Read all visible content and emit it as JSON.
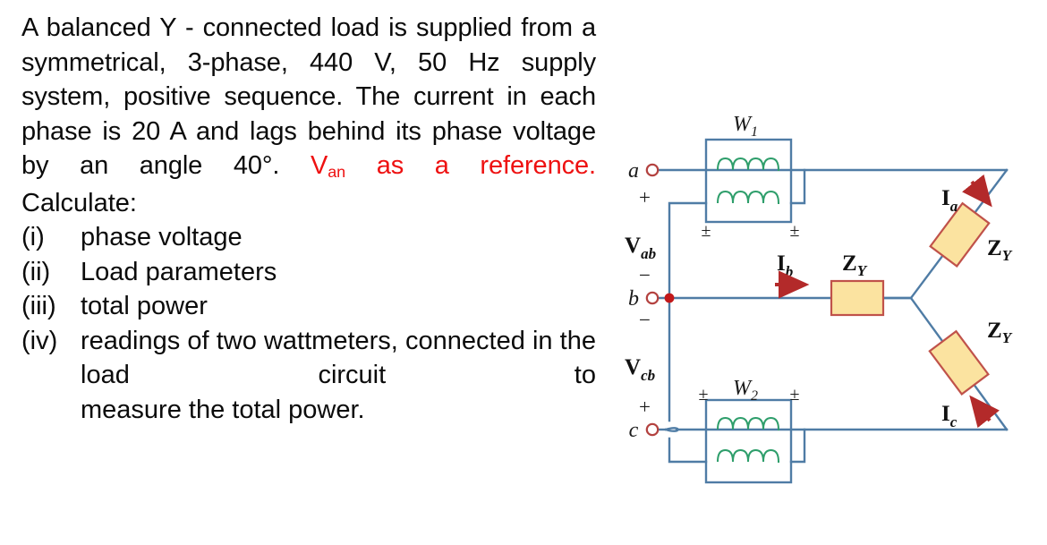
{
  "question": {
    "body_lines": [
      "A balanced Y - connected load is",
      "supplied from a symmetrical, 3-phase,",
      "440 V, 50 Hz supply system, positive",
      "sequence. The current in each phase is",
      "20 A and lags behind its phase voltage",
      "by an angle 40°."
    ],
    "line1": "A balanced Y - connected load is",
    "line2": "supplied from a symmetrical, 3-phase,",
    "line3": "440 V, 50 Hz supply system, positive",
    "line4": "sequence. The current in each phase is",
    "line5": "20 A and lags behind its phase voltage",
    "line6_prefix": "by an angle 40°.",
    "reference_note": {
      "symbol": "V",
      "symbol_sub": "an",
      "rest": " as a reference.",
      "color": "#ee1111"
    },
    "calculate_label": "Calculate:",
    "items": [
      {
        "marker": "(i)",
        "text": "phase voltage"
      },
      {
        "marker": "(ii)",
        "text": "Load parameters"
      },
      {
        "marker": "(iii)",
        "text": "total power"
      },
      {
        "marker": "(iv)",
        "text": "readings of two wattmeters,",
        "cont1": "connected in the load circuit to",
        "cont2": "measure the total power."
      }
    ]
  },
  "diagram": {
    "title": "two-wattmeter-method-circuit",
    "colors": {
      "wire": "#4f7ca5",
      "coil": "#2e9e6b",
      "impedance_fill": "#fbe3a0",
      "impedance_stroke": "#c0524a",
      "terminal_stroke": "#b3413f",
      "node_dot": "#c2181a",
      "arrow": "#b32a2a"
    },
    "terminals": [
      {
        "name": "a",
        "label": "a"
      },
      {
        "name": "b",
        "label": "b"
      },
      {
        "name": "c",
        "label": "c"
      }
    ],
    "wattmeters": [
      {
        "name": "W1",
        "label": "W",
        "sub": "1",
        "polarity_left": "±",
        "polarity_right": "±"
      },
      {
        "name": "W2",
        "label": "W",
        "sub": "2",
        "polarity_left": "±",
        "polarity_right": "±"
      }
    ],
    "voltage_labels": [
      {
        "name": "Vab",
        "symbol": "V",
        "sub": "ab",
        "plus": "+",
        "minus": "−"
      },
      {
        "name": "Vcb",
        "symbol": "V",
        "sub": "cb",
        "plus": "+",
        "minus": "−"
      }
    ],
    "current_labels": [
      {
        "name": "Ia",
        "symbol": "I",
        "sub": "a"
      },
      {
        "name": "Ib",
        "symbol": "I",
        "sub": "b"
      },
      {
        "name": "Ic",
        "symbol": "I",
        "sub": "c"
      }
    ],
    "impedance_labels": [
      {
        "name": "Zy-phase-a",
        "symbol": "Z",
        "sub": "Y"
      },
      {
        "name": "Zy-phase-b",
        "symbol": "Z",
        "sub": "Y"
      },
      {
        "name": "Zy-phase-c",
        "symbol": "Z",
        "sub": "Y"
      }
    ]
  }
}
